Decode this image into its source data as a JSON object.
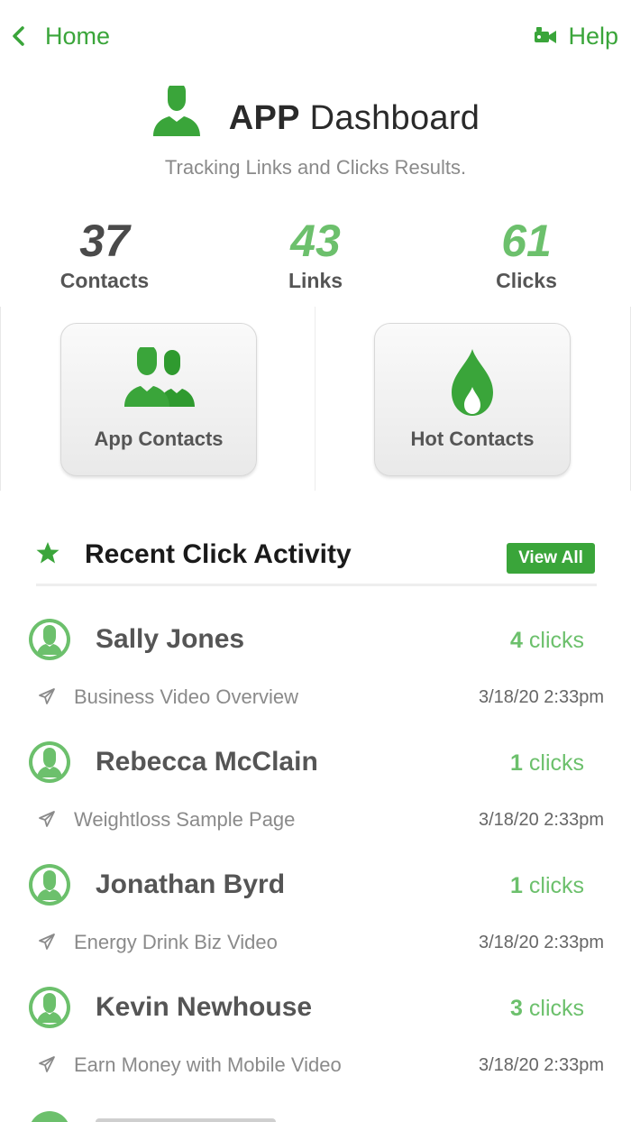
{
  "nav": {
    "back_label": "Home",
    "help_label": "Help"
  },
  "header": {
    "title_bold": "APP",
    "title_rest": "Dashboard",
    "subtitle": "Tracking Links and Clicks Results."
  },
  "stats": [
    {
      "value": "37",
      "label": "Contacts"
    },
    {
      "value": "43",
      "label": "Links"
    },
    {
      "value": "61",
      "label": "Clicks"
    }
  ],
  "tiles": {
    "app_contacts": "App Contacts",
    "hot_contacts": "Hot Contacts"
  },
  "recent": {
    "title": "Recent Click Activity",
    "view_all": "View All",
    "click_word": "clicks",
    "items": [
      {
        "name": "Sally Jones",
        "count": "4",
        "page": "Business Video Overview",
        "time": "3/18/20 2:33pm"
      },
      {
        "name": "Rebecca McClain",
        "count": "1",
        "page": "Weightloss Sample Page",
        "time": "3/18/20 2:33pm"
      },
      {
        "name": "Jonathan Byrd",
        "count": "1",
        "page": "Energy Drink Biz Video",
        "time": "3/18/20 2:33pm"
      },
      {
        "name": "Kevin Newhouse",
        "count": "3",
        "page": "Earn Money with Mobile Video",
        "time": "3/18/20 2:33pm"
      }
    ]
  },
  "colors": {
    "accent": "#3aa53a",
    "accent_light": "#6cc06c",
    "text_dark": "#2a2a2a",
    "text_muted": "#8a8a8a"
  }
}
